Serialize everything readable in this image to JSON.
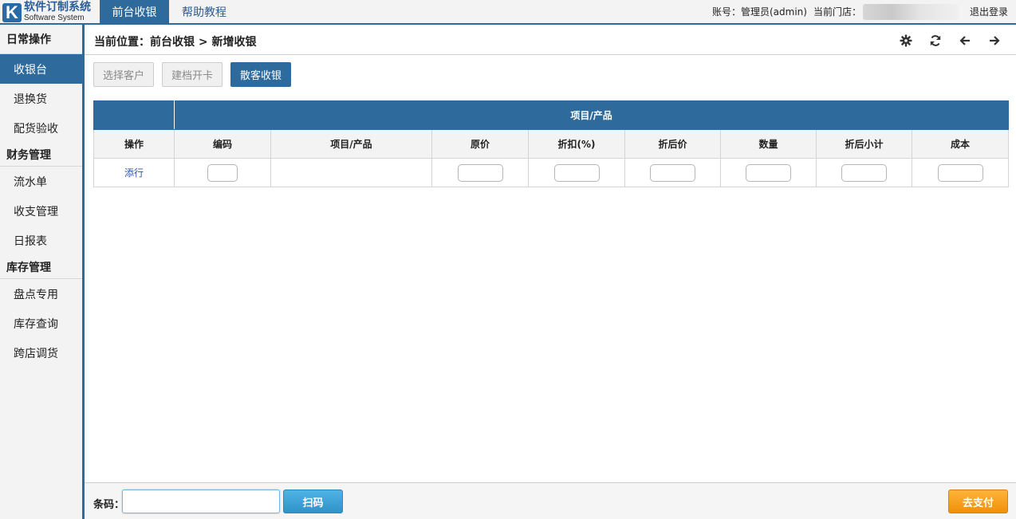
{
  "app": {
    "logo_letter": "K",
    "logo_cn": "软件订制系统",
    "logo_en": "Software System"
  },
  "top_nav": {
    "tabs": [
      {
        "label": "前台收银"
      },
      {
        "label": "帮助教程"
      }
    ],
    "account_label": "账号：管理员(admin)",
    "store_label": "当前门店：",
    "logout_label": "退出登录"
  },
  "sidebar": {
    "groups": [
      {
        "title": "日常操作",
        "items": [
          {
            "label": "收银台"
          },
          {
            "label": "退换货"
          },
          {
            "label": "配货验收"
          }
        ]
      },
      {
        "title": "财务管理",
        "items": [
          {
            "label": "流水单"
          },
          {
            "label": "收支管理"
          },
          {
            "label": "日报表"
          }
        ]
      },
      {
        "title": "库存管理",
        "items": [
          {
            "label": "盘点专用"
          },
          {
            "label": "库存查询"
          },
          {
            "label": "跨店调货"
          }
        ]
      }
    ]
  },
  "breadcrumb": "当前位置：前台收银 > 新增收银",
  "toolbar_icons": [
    "gear-icon",
    "refresh-icon",
    "arrow-left-icon",
    "arrow-right-icon"
  ],
  "buttons": {
    "select_customer": "选择客户",
    "create_card": "建档开卡",
    "walk_in": "散客收银"
  },
  "table": {
    "group_header": "项目/产品",
    "columns": [
      "操作",
      "编码",
      "项目/产品",
      "原价",
      "折扣(%)",
      "折后价",
      "数量",
      "折后小计",
      "成本"
    ],
    "row_action": "添行"
  },
  "bottom": {
    "barcode_label": "条码：",
    "barcode_value": "",
    "scan_label": "扫码",
    "pay_label": "去支付"
  },
  "colors": {
    "primary": "#2e6a9c",
    "scan": "#3aa3d6",
    "pay": "#f5a020"
  }
}
